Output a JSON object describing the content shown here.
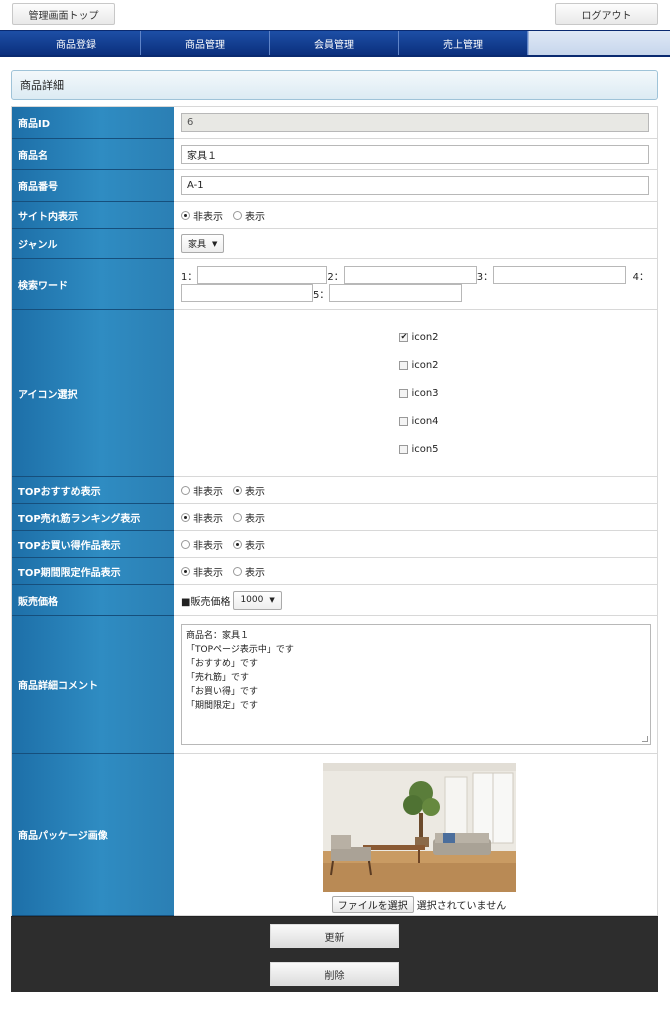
{
  "topbar": {
    "admin_top": "管理画面トップ",
    "logout": "ログアウト"
  },
  "nav": {
    "items": [
      "商品登録",
      "商品管理",
      "会員管理",
      "売上管理"
    ]
  },
  "section": {
    "title": "商品詳細"
  },
  "form": {
    "product_id": {
      "label": "商品ID",
      "value": "6"
    },
    "product_name": {
      "label": "商品名",
      "value": "家具１"
    },
    "product_number": {
      "label": "商品番号",
      "value": "A-1"
    },
    "site_display": {
      "label": "サイト内表示",
      "options": [
        "非表示",
        "表示"
      ],
      "selected": "非表示"
    },
    "genre": {
      "label": "ジャンル",
      "selected": "家具"
    },
    "keywords": {
      "label": "検索ワード",
      "labels": [
        "1：",
        "2：",
        "3：",
        "4：",
        "5："
      ],
      "values": [
        "",
        "",
        "",
        "",
        ""
      ]
    },
    "icons": {
      "label": "アイコン選択",
      "items": [
        {
          "name": "icon2",
          "checked": true
        },
        {
          "name": "icon2",
          "checked": false
        },
        {
          "name": "icon3",
          "checked": false
        },
        {
          "name": "icon4",
          "checked": false
        },
        {
          "name": "icon5",
          "checked": false
        }
      ]
    },
    "top_recommend": {
      "label": "TOPおすすめ表示",
      "options": [
        "非表示",
        "表示"
      ],
      "selected": "表示"
    },
    "top_ranking": {
      "label": "TOP売れ筋ランキング表示",
      "options": [
        "非表示",
        "表示"
      ],
      "selected": "非表示"
    },
    "top_bargain": {
      "label": "TOPお買い得作品表示",
      "options": [
        "非表示",
        "表示"
      ],
      "selected": "表示"
    },
    "top_limited": {
      "label": "TOP期間限定作品表示",
      "options": [
        "非表示",
        "表示"
      ],
      "selected": "非表示"
    },
    "price": {
      "label": "販売価格",
      "prefix": "■販売価格",
      "selected": "1000"
    },
    "comment": {
      "label": "商品詳細コメント",
      "value": "商品名：家具１\n「TOPページ表示中」です\n「おすすめ」です\n「売れ筋」です\n「お買い得」です\n「期間限定」です"
    },
    "package_image": {
      "label": "商品パッケージ画像",
      "file_button": "ファイルを選択",
      "file_status": "選択されていません"
    }
  },
  "actions": {
    "update": "更新",
    "delete": "削除"
  }
}
